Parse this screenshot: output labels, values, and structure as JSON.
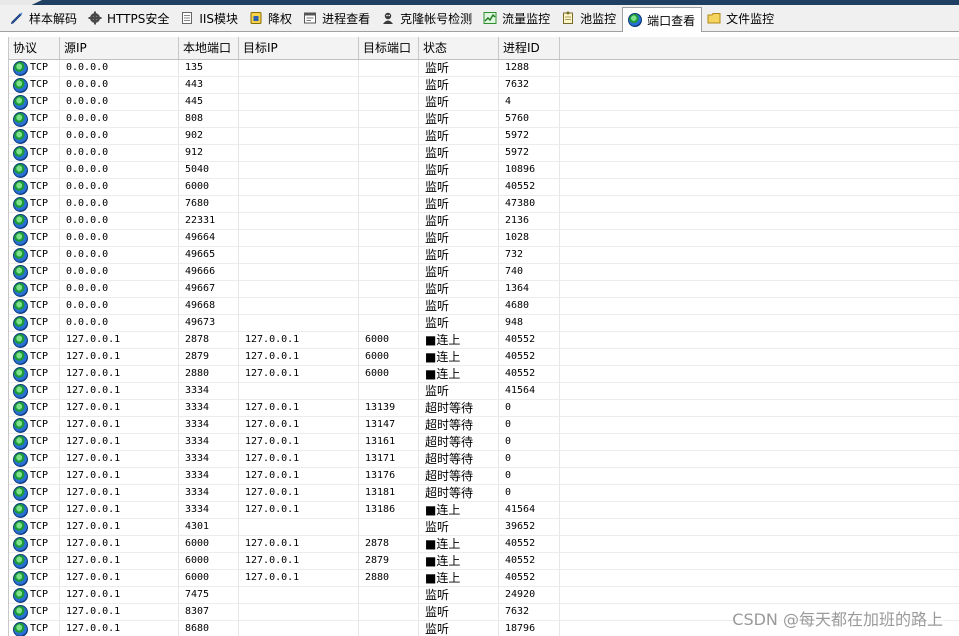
{
  "tabs": [
    {
      "label": "样本解码",
      "icon": "pen-icon"
    },
    {
      "label": "HTTPS安全",
      "icon": "gear-icon"
    },
    {
      "label": "IIS模块",
      "icon": "document-icon"
    },
    {
      "label": "降权",
      "icon": "lock-icon"
    },
    {
      "label": "进程查看",
      "icon": "window-icon"
    },
    {
      "label": "克隆帐号检测",
      "icon": "user-icon"
    },
    {
      "label": "流量监控",
      "icon": "chart-icon"
    },
    {
      "label": "池监控",
      "icon": "notepad-icon"
    },
    {
      "label": "端口查看",
      "icon": "globe-icon",
      "active": true
    },
    {
      "label": "文件监控",
      "icon": "folder-icon"
    }
  ],
  "columns": [
    "协议",
    "源IP",
    "本地端口",
    "目标IP",
    "目标端口",
    "状态",
    "进程ID",
    ""
  ],
  "rows": [
    [
      "TCP",
      "0.0.0.0",
      "135",
      "",
      "",
      "监听",
      "1288"
    ],
    [
      "TCP",
      "0.0.0.0",
      "443",
      "",
      "",
      "监听",
      "7632"
    ],
    [
      "TCP",
      "0.0.0.0",
      "445",
      "",
      "",
      "监听",
      "4"
    ],
    [
      "TCP",
      "0.0.0.0",
      "808",
      "",
      "",
      "监听",
      "5760"
    ],
    [
      "TCP",
      "0.0.0.0",
      "902",
      "",
      "",
      "监听",
      "5972"
    ],
    [
      "TCP",
      "0.0.0.0",
      "912",
      "",
      "",
      "监听",
      "5972"
    ],
    [
      "TCP",
      "0.0.0.0",
      "5040",
      "",
      "",
      "监听",
      "10896"
    ],
    [
      "TCP",
      "0.0.0.0",
      "6000",
      "",
      "",
      "监听",
      "40552"
    ],
    [
      "TCP",
      "0.0.0.0",
      "7680",
      "",
      "",
      "监听",
      "47380"
    ],
    [
      "TCP",
      "0.0.0.0",
      "22331",
      "",
      "",
      "监听",
      "2136"
    ],
    [
      "TCP",
      "0.0.0.0",
      "49664",
      "",
      "",
      "监听",
      "1028"
    ],
    [
      "TCP",
      "0.0.0.0",
      "49665",
      "",
      "",
      "监听",
      "732"
    ],
    [
      "TCP",
      "0.0.0.0",
      "49666",
      "",
      "",
      "监听",
      "740"
    ],
    [
      "TCP",
      "0.0.0.0",
      "49667",
      "",
      "",
      "监听",
      "1364"
    ],
    [
      "TCP",
      "0.0.0.0",
      "49668",
      "",
      "",
      "监听",
      "4680"
    ],
    [
      "TCP",
      "0.0.0.0",
      "49673",
      "",
      "",
      "监听",
      "948"
    ],
    [
      "TCP",
      "127.0.0.1",
      "2878",
      "127.0.0.1",
      "6000",
      "■连上",
      "40552"
    ],
    [
      "TCP",
      "127.0.0.1",
      "2879",
      "127.0.0.1",
      "6000",
      "■连上",
      "40552"
    ],
    [
      "TCP",
      "127.0.0.1",
      "2880",
      "127.0.0.1",
      "6000",
      "■连上",
      "40552"
    ],
    [
      "TCP",
      "127.0.0.1",
      "3334",
      "",
      "",
      "监听",
      "41564"
    ],
    [
      "TCP",
      "127.0.0.1",
      "3334",
      "127.0.0.1",
      "13139",
      "超时等待",
      "0"
    ],
    [
      "TCP",
      "127.0.0.1",
      "3334",
      "127.0.0.1",
      "13147",
      "超时等待",
      "0"
    ],
    [
      "TCP",
      "127.0.0.1",
      "3334",
      "127.0.0.1",
      "13161",
      "超时等待",
      "0"
    ],
    [
      "TCP",
      "127.0.0.1",
      "3334",
      "127.0.0.1",
      "13171",
      "超时等待",
      "0"
    ],
    [
      "TCP",
      "127.0.0.1",
      "3334",
      "127.0.0.1",
      "13176",
      "超时等待",
      "0"
    ],
    [
      "TCP",
      "127.0.0.1",
      "3334",
      "127.0.0.1",
      "13181",
      "超时等待",
      "0"
    ],
    [
      "TCP",
      "127.0.0.1",
      "3334",
      "127.0.0.1",
      "13186",
      "■连上",
      "41564"
    ],
    [
      "TCP",
      "127.0.0.1",
      "4301",
      "",
      "",
      "监听",
      "39652"
    ],
    [
      "TCP",
      "127.0.0.1",
      "6000",
      "127.0.0.1",
      "2878",
      "■连上",
      "40552"
    ],
    [
      "TCP",
      "127.0.0.1",
      "6000",
      "127.0.0.1",
      "2879",
      "■连上",
      "40552"
    ],
    [
      "TCP",
      "127.0.0.1",
      "6000",
      "127.0.0.1",
      "2880",
      "■连上",
      "40552"
    ],
    [
      "TCP",
      "127.0.0.1",
      "7475",
      "",
      "",
      "监听",
      "24920"
    ],
    [
      "TCP",
      "127.0.0.1",
      "8307",
      "",
      "",
      "监听",
      "7632"
    ],
    [
      "TCP",
      "127.0.0.1",
      "8680",
      "",
      "",
      "监听",
      "18796"
    ]
  ],
  "watermark": "CSDN @每天都在加班的路上"
}
